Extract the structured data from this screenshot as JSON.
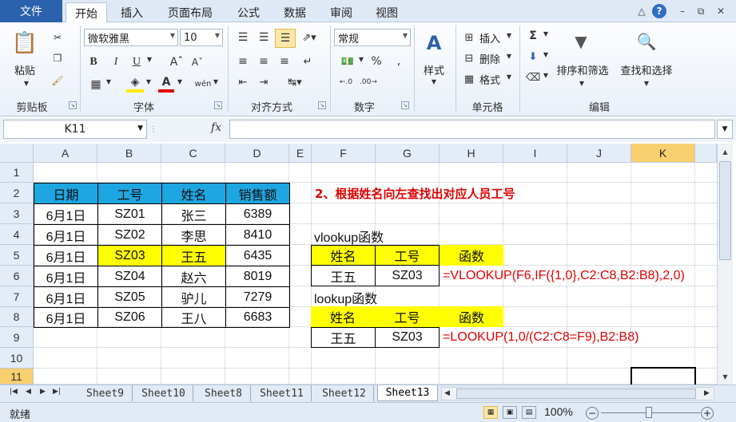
{
  "ribbon_tabs": {
    "file": "文件",
    "tabs": [
      "开始",
      "插入",
      "页面布局",
      "公式",
      "数据",
      "审阅",
      "视图"
    ],
    "active": "开始"
  },
  "ribbon": {
    "clipboard": {
      "paste": "粘贴",
      "group": "剪贴板"
    },
    "font": {
      "name": "微软雅黑",
      "size": "10",
      "group": "字体",
      "bold": "B",
      "italic": "I",
      "underline": "U"
    },
    "alignment": {
      "group": "对齐方式"
    },
    "number": {
      "format": "常规",
      "group": "数字",
      "percent": "%"
    },
    "styles": {
      "label": "样式"
    },
    "cells": {
      "insert": "插入",
      "delete": "删除",
      "format": "格式",
      "group": "单元格"
    },
    "editing": {
      "sigma": "Σ",
      "sort": "排序和筛选",
      "find": "查找和选择",
      "group": "编辑"
    }
  },
  "formula_bar": {
    "name_box": "K11",
    "fx": "fx",
    "formula": ""
  },
  "grid": {
    "columns": [
      "A",
      "B",
      "C",
      "D",
      "E",
      "F",
      "G",
      "H",
      "I",
      "J",
      "K"
    ],
    "rows": [
      "1",
      "2",
      "3",
      "4",
      "5",
      "6",
      "7",
      "8",
      "9",
      "10",
      "11"
    ],
    "selected_column": "K",
    "selected_row": "11"
  },
  "sales_table": {
    "headers": [
      "日期",
      "工号",
      "姓名",
      "销售额"
    ],
    "rows": [
      [
        "6月1日",
        "SZ01",
        "张三",
        "6389"
      ],
      [
        "6月1日",
        "SZ02",
        "李思",
        "8410"
      ],
      [
        "6月1日",
        "SZ03",
        "王五",
        "6435"
      ],
      [
        "6月1日",
        "SZ04",
        "赵六",
        "8019"
      ],
      [
        "6月1日",
        "SZ05",
        "驴儿",
        "7279"
      ],
      [
        "6月1日",
        "SZ06",
        "王八",
        "6683"
      ]
    ]
  },
  "heading": "2、根据姓名向左查找出对应人员工号",
  "vlookup_block": {
    "title": "vlookup函数",
    "headers": [
      "姓名",
      "工号",
      "函数"
    ],
    "name": "王五",
    "id": "SZ03",
    "formula": "=VLOOKUP(F6,IF({1,0},C2:C8,B2:B8),2,0)"
  },
  "lookup_block": {
    "title": "lookup函数",
    "headers": [
      "姓名",
      "工号",
      "函数"
    ],
    "name": "王五",
    "id": "SZ03",
    "formula": "=LOOKUP(1,0/(C2:C8=F9),B2:B8)"
  },
  "sheet_tabs": [
    "Sheet9",
    "Sheet10",
    "Sheet8",
    "Sheet11",
    "Sheet12",
    "Sheet13"
  ],
  "active_sheet": "Sheet13",
  "status": {
    "ready": "就绪",
    "zoom": "100%"
  },
  "colors": {
    "blue_header": "#1ea6e0",
    "yellow_header": "#ffff00",
    "red_text": "#e00000",
    "file_tab": "#2b62ad"
  }
}
